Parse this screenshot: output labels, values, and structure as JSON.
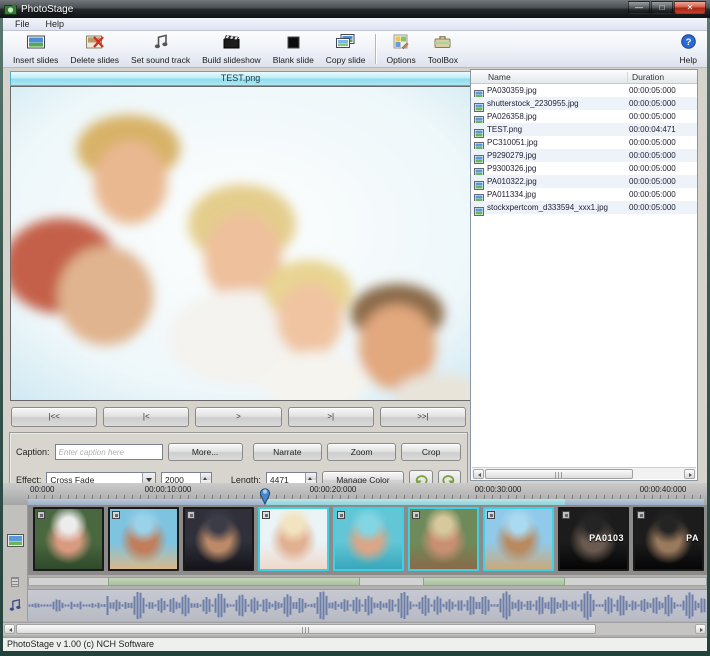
{
  "window": {
    "title": "PhotoStage"
  },
  "menu": {
    "items": [
      {
        "label": "File"
      },
      {
        "label": "Help"
      }
    ]
  },
  "toolbar": {
    "buttons": [
      {
        "label": "Insert slides",
        "icon": "insert-slide-icon",
        "group": 1
      },
      {
        "label": "Delete slides",
        "icon": "delete-slide-icon",
        "group": 1
      },
      {
        "label": "Set sound track",
        "icon": "sound-track-icon",
        "group": 1
      },
      {
        "label": "Build slideshow",
        "icon": "build-slideshow-icon",
        "group": 1
      },
      {
        "label": "Blank slide",
        "icon": "blank-slide-icon",
        "group": 1
      },
      {
        "label": "Copy slide",
        "icon": "copy-slide-icon",
        "group": 1
      },
      {
        "label": "Options",
        "icon": "options-icon",
        "group": 2
      },
      {
        "label": "ToolBox",
        "icon": "toolbox-icon",
        "group": 2
      },
      {
        "label": "Help",
        "icon": "help-icon",
        "group": 3
      }
    ]
  },
  "preview": {
    "title": "TEST.png"
  },
  "transport": {
    "buttons": [
      {
        "label": "|<<",
        "name": "go-to-start-button"
      },
      {
        "label": "|<",
        "name": "previous-slide-button"
      },
      {
        "label": ">",
        "name": "play-button"
      },
      {
        "label": ">|",
        "name": "next-slide-button"
      },
      {
        "label": ">>|",
        "name": "go-to-end-button"
      }
    ]
  },
  "slide_controls": {
    "caption_label": "Caption:",
    "caption_value": "",
    "caption_placeholder": "Enter caption here",
    "more_label": "More...",
    "narrate_label": "Narrate",
    "zoom_label": "Zoom",
    "crop_label": "Crop",
    "effect_label": "Effect:",
    "effect_value": "Cross Fade",
    "effect_duration": "2000",
    "length_label": "Length:",
    "length_value": "4471",
    "manage_color_label": "Manage Color"
  },
  "file_list": {
    "columns": [
      {
        "label": "Name"
      },
      {
        "label": "Duration"
      }
    ],
    "rows": [
      {
        "name": "PA030359.jpg",
        "duration": "00:00:05:000"
      },
      {
        "name": "shutterstock_2230955.jpg",
        "duration": "00:00:05:000"
      },
      {
        "name": "PA026358.jpg",
        "duration": "00:00:05:000"
      },
      {
        "name": "TEST.png",
        "duration": "00:00:04:471"
      },
      {
        "name": "PC310051.jpg",
        "duration": "00:00:05:000"
      },
      {
        "name": "P9290279.jpg",
        "duration": "00:00:05:000"
      },
      {
        "name": "P9300326.jpg",
        "duration": "00:00:05:000"
      },
      {
        "name": "PA010322.jpg",
        "duration": "00:00:05:000"
      },
      {
        "name": "PA011334.jpg",
        "duration": "00:00:05:000"
      },
      {
        "name": "stockxpertcom_d333594_xxx1.jpg",
        "duration": "00:00:05:000"
      }
    ]
  },
  "timeline": {
    "ruler_ticks": [
      "00:000",
      "00:00:10:000",
      "00:00:20:000",
      "00:00:30:000",
      "00:00:40:000"
    ],
    "thumbnails": [
      {
        "name": "slide-girl-cap",
        "selected": false,
        "label": "",
        "c1": "#4a6840",
        "c2": "#2f4a2a",
        "c3": "#d89a80",
        "c4": "#ececec"
      },
      {
        "name": "slide-beach-lounger",
        "selected": false,
        "label": "",
        "c1": "#7ec3e0",
        "c2": "#d7b98c",
        "c3": "#c27d5a",
        "c4": "#9ad2ea"
      },
      {
        "name": "slide-man-portrait",
        "selected": false,
        "label": "",
        "c1": "#30303a",
        "c2": "#14141a",
        "c3": "#bc8a68",
        "c4": "#3c3c48"
      },
      {
        "name": "slide-family",
        "selected": true,
        "label": "",
        "c1": "#eaf3f6",
        "c2": "#f0d9cc",
        "c3": "#e2b092",
        "c4": "#f2e4c0"
      },
      {
        "name": "slide-pool",
        "selected": true,
        "label": "",
        "c1": "#62c6d6",
        "c2": "#39a7ba",
        "c3": "#daa687",
        "c4": "#82d6e4"
      },
      {
        "name": "slide-market",
        "selected": true,
        "label": "",
        "c1": "#6e8a5a",
        "c2": "#8a6a48",
        "c3": "#c98f72",
        "c4": "#d6c99c"
      },
      {
        "name": "slide-beach-kayak",
        "selected": true,
        "label": "",
        "c1": "#90c9e9",
        "c2": "#caa97c",
        "c3": "#b98a60",
        "c4": "#aadaf1"
      },
      {
        "name": "slide-pa0103",
        "selected": false,
        "label": "PA0103",
        "c1": "#1c1c1c",
        "c2": "#050505",
        "c3": "#6a5a50",
        "c4": "#242424"
      },
      {
        "name": "slide-pa-partial",
        "selected": false,
        "label": "PA",
        "c1": "#1c1c1c",
        "c2": "#060606",
        "c3": "#9a7a5e",
        "c4": "#242424"
      }
    ],
    "selection_color": "#3fd0e4",
    "waveform_color": "#6d7fa9"
  },
  "status_bar": {
    "text": "PhotoStage v 1.00 (c) NCH Software"
  }
}
